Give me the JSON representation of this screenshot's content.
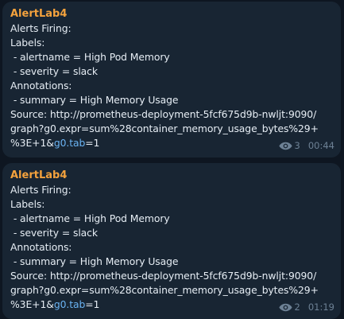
{
  "messages": [
    {
      "sender": "AlertLab4",
      "lines": [
        "Alerts Firing:",
        "Labels:",
        " - alertname = High Pod Memory",
        " - severity = slack",
        "Annotations:",
        " - summary = High Memory Usage",
        "Source: http://prometheus-deployment-5fcf675d9b-nwljt:9090/",
        "graph?g0.expr=sum%28container_memory_usage_bytes%29+"
      ],
      "last_line_prefix": "%3E+1&",
      "last_line_link": "g0.tab",
      "last_line_suffix": "=1",
      "views": "3",
      "time": "00:44"
    },
    {
      "sender": "AlertLab4",
      "lines": [
        "Alerts Firing:",
        "Labels:",
        " - alertname = High Pod Memory",
        " - severity = slack",
        "Annotations:",
        " - summary = High Memory Usage",
        "Source: http://prometheus-deployment-5fcf675d9b-nwljt:9090/",
        "graph?g0.expr=sum%28container_memory_usage_bytes%29+"
      ],
      "last_line_prefix": "%3E+1&",
      "last_line_link": "g0.tab",
      "last_line_suffix": "=1",
      "views": "2",
      "time": "01:19"
    }
  ],
  "colors": {
    "background": "#0e1621",
    "bubble": "#182533",
    "sender": "#f4a23d",
    "text": "#e6edf4",
    "link": "#6ab3f3",
    "meta": "#6d8195"
  },
  "icons": {
    "views": "eye-icon"
  }
}
